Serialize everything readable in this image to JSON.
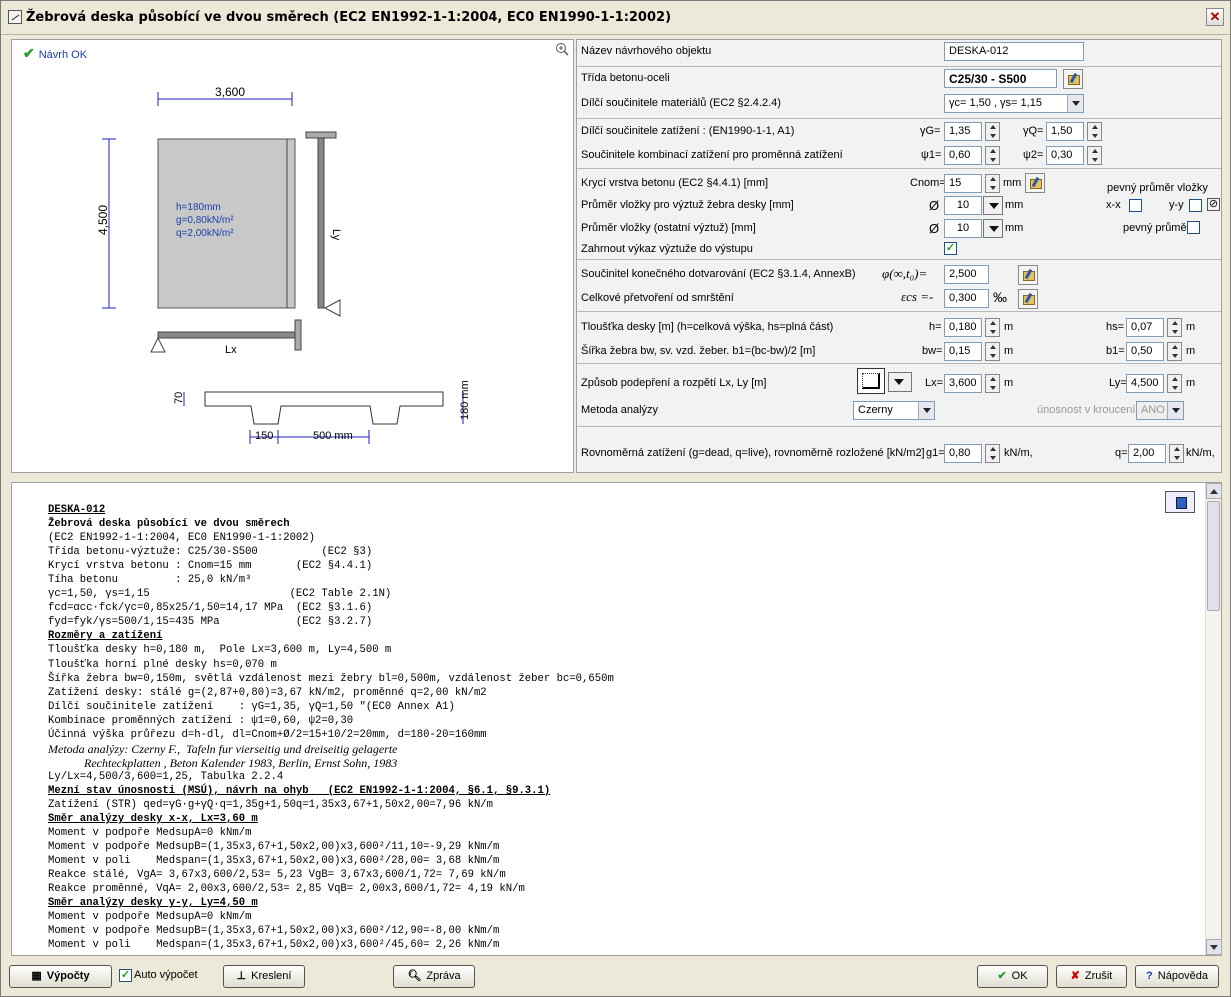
{
  "window": {
    "title": "Žebrová deska působící ve dvou směrech (EC2 EN1992-1-1:2004, EC0 EN1990-1-1:2002)",
    "close": "✕"
  },
  "drawing": {
    "status": "Návrh OK",
    "lx_dim": "3,600",
    "ly_dim": "4,500",
    "ly_label": "Ly",
    "lx_label": "Lx",
    "slab_h": "h=180mm",
    "slab_g": "g=0,80kN/m²",
    "slab_q": "q=2,00kN/m²",
    "sec_flange": "70",
    "sec_total": "180 mm",
    "sec_bw": "150",
    "sec_b1": "500 mm"
  },
  "form": {
    "name_label": "Název návrhového objektu",
    "name_value": "DESKA-012",
    "class_label": "Třída betonu-oceli",
    "class_value": "C25/30 - S500",
    "mat_label": "Dílčí součinitele materiálů (EC2 §2.4.2.4)",
    "mat_value": "γc= 1,50 , γs= 1,15",
    "load_label": "Dílčí součinitele zatížení   : (EN1990-1-1, A1)",
    "gG_label": "γG=",
    "gG_value": "1,35",
    "gQ_label": "γQ=",
    "gQ_value": "1,50",
    "comb_label": "Součinitele kombinací zatížení pro proměnná zatížení",
    "psi1_label": "ψ1=",
    "psi1_value": "0,60",
    "psi2_label": "ψ2=",
    "psi2_value": "0,30",
    "cover_label": "Krycí vrstva betonu (EC2 §4.4.1) [mm]",
    "cnom_label": "Cnom=",
    "cnom_value": "15",
    "mm": "mm",
    "fixed_diam_label": "pevný průměr vložky",
    "xx_label": "x-x",
    "yy_label": "y-y",
    "rib_diam_label": "Průměr vložky pro výztuž žebra desky [mm]",
    "rib_diam_value": "10",
    "diam_symbol": "Ø",
    "other_diam_label": "Průměr vložky (ostatní výztuž) [mm]",
    "other_diam_value": "10",
    "fixed_diam2_label": "pevný průměr",
    "include_label": "Zahrnout výkaz výztuže do výstupu",
    "creep_label": "Součinitel konečného dotvarování (EC2 §3.1.4, AnnexB)",
    "creep_symbol": "φ(∞,t₀)=",
    "creep_value": "2,500",
    "shrink_label": "Celkové přetvoření od smrštění",
    "shrink_symbol": "εcs =-",
    "shrink_value": "0,300",
    "shrink_unit": "‰",
    "thick_label": "Tloušťka desky [m] (h=celková výška, hs=plná část)",
    "h_label": "h=",
    "h_value": "0,180",
    "hs_label": "hs=",
    "hs_value": "0,07",
    "m": "m",
    "rib_label": "Šířka žebra bw, sv. vzd. žeber. b1=(bc-bw)/2 [m]",
    "bw_label": "bw=",
    "bw_value": "0,15",
    "b1_label": "b1=",
    "b1_value": "0,50",
    "support_label": "Způsob podepření a rozpětí Lx, Ly [m]",
    "lx_label": "Lx=",
    "lx_value": "3,600",
    "ly_label": "Ly=",
    "ly_value": "4,500",
    "method_label": "Metoda analýzy",
    "method_value": "Czerny",
    "torsion_label": "únosnost v kroucení",
    "torsion_value": "ANO",
    "uniform_label": "Rovnoměrná zatížení (g=dead, q=live), rovnoměrně rozložené [kN/m2]",
    "g1_label": "g1=",
    "g1_value": "0,80",
    "q_label": "q=",
    "q_value": "2,00",
    "knm": "kN/m,"
  },
  "report": {
    "lines": [
      {
        "t": "DESKA-012",
        "s": "u"
      },
      {
        "t": "Žebrová deska působící ve dvou směrech",
        "s": "b"
      },
      {
        "t": "(EC2 EN1992-1-1:2004, EC0 EN1990-1-1:2002)",
        "s": ""
      },
      {
        "t": "Třída betonu-výztuže: C25/30-S500          (EC2 §3)",
        "s": ""
      },
      {
        "t": "Krycí vrstva betonu : Cnom=15 mm       (EC2 §4.4.1)",
        "s": ""
      },
      {
        "t": "Tíha betonu         : 25,0 kN/m³",
        "s": ""
      },
      {
        "t": "γc=1,50, γs=1,15                      (EC2 Table 2.1N)",
        "s": ""
      },
      {
        "t": "fcd=αcc·fck/γc=0,85x25/1,50=14,17 MPa  (EC2 §3.1.6)",
        "s": ""
      },
      {
        "t": "fyd=fyk/γs=500/1,15=435 MPa            (EC2 §3.2.7)",
        "s": ""
      },
      {
        "t": "Rozměry a zatížení",
        "s": "u"
      },
      {
        "t": "Tloušťka desky h=0,180 m,  Pole Lx=3,600 m, Ly=4,500 m",
        "s": ""
      },
      {
        "t": "Tloušťka horní plné desky hs=0,070 m",
        "s": ""
      },
      {
        "t": "Šířka žebra bw=0,150m, světlá vzdálenost mezi žebry bl=0,500m, vzdálenost žeber bc=0,650m",
        "s": ""
      },
      {
        "t": "Zatížení desky: stálé g=(2,87+0,80)=3,67 kN/m2, proměnné q=2,00 kN/m2",
        "s": ""
      },
      {
        "t": "Dílčí součinitele zatížení    : γG=1,35, γQ=1,50 \"(EC0 Annex A1)",
        "s": ""
      },
      {
        "t": "Kombinace proměnných zatížení : ψ1=0,60, ψ2=0,30",
        "s": ""
      },
      {
        "t": "Účinná výška průřezu d=h-dl, dl=Cnom+Ø/2=15+10/2=20mm, d=180-20=160mm",
        "s": ""
      },
      {
        "t": "Metoda analýzy: Czerny F.,  Tafeln fur vierseitig und dreiseitig gelagerte",
        "s": "i"
      },
      {
        "t": "            Rechteckplatten , Beton Kalender 1983, Berlin, Ernst Sohn, 1983",
        "s": "i"
      },
      {
        "t": "Ly/Lx=4,500/3,600=1,25, Tabulka 2.2.4",
        "s": ""
      },
      {
        "t": "Mezní stav únosnosti (MSÚ), návrh na ohyb   (EC2 EN1992-1-1:2004, §6.1, §9.3.1)",
        "s": "u"
      },
      {
        "t": "Zatížení (STR) qed=γG·g+γQ·q=1,35g+1,50q=1,35x3,67+1,50x2,00=7,96 kN/m",
        "s": ""
      },
      {
        "t": "Směr analýzy desky x-x, Lx=3,60 m",
        "s": "u"
      },
      {
        "t": "Moment v podpoře MedsupA=0 kNm/m",
        "s": ""
      },
      {
        "t": "Moment v podpoře MedsupB=(1,35x3,67+1,50x2,00)x3,600²/11,10=-9,29 kNm/m",
        "s": ""
      },
      {
        "t": "Moment v poli    Medspan=(1,35x3,67+1,50x2,00)x3,600²/28,00= 3,68 kNm/m",
        "s": ""
      },
      {
        "t": "Reakce stálé, VgA= 3,67x3,600/2,53= 5,23 VgB= 3,67x3,600/1,72= 7,69 kN/m",
        "s": ""
      },
      {
        "t": "Reakce proměnné, VqA= 2,00x3,600/2,53= 2,85 VqB= 2,00x3,600/1,72= 4,19 kN/m",
        "s": ""
      },
      {
        "t": "Směr analýzy desky y-y, Ly=4,50 m",
        "s": "u"
      },
      {
        "t": "Moment v podpoře MedsupA=0 kNm/m",
        "s": ""
      },
      {
        "t": "Moment v podpoře MedsupB=(1,35x3,67+1,50x2,00)x3,600²/12,90=-8,00 kNm/m",
        "s": ""
      },
      {
        "t": "Moment v poli    Medspan=(1,35x3,67+1,50x2,00)x3,600²/45,60= 2,26 kNm/m",
        "s": ""
      }
    ]
  },
  "bottom": {
    "calc": "Výpočty",
    "auto": "Auto výpočet",
    "draw": "Kreslení",
    "report": "Zpráva",
    "ok": "OK",
    "cancel": "Zrušit",
    "help": "Nápověda"
  }
}
